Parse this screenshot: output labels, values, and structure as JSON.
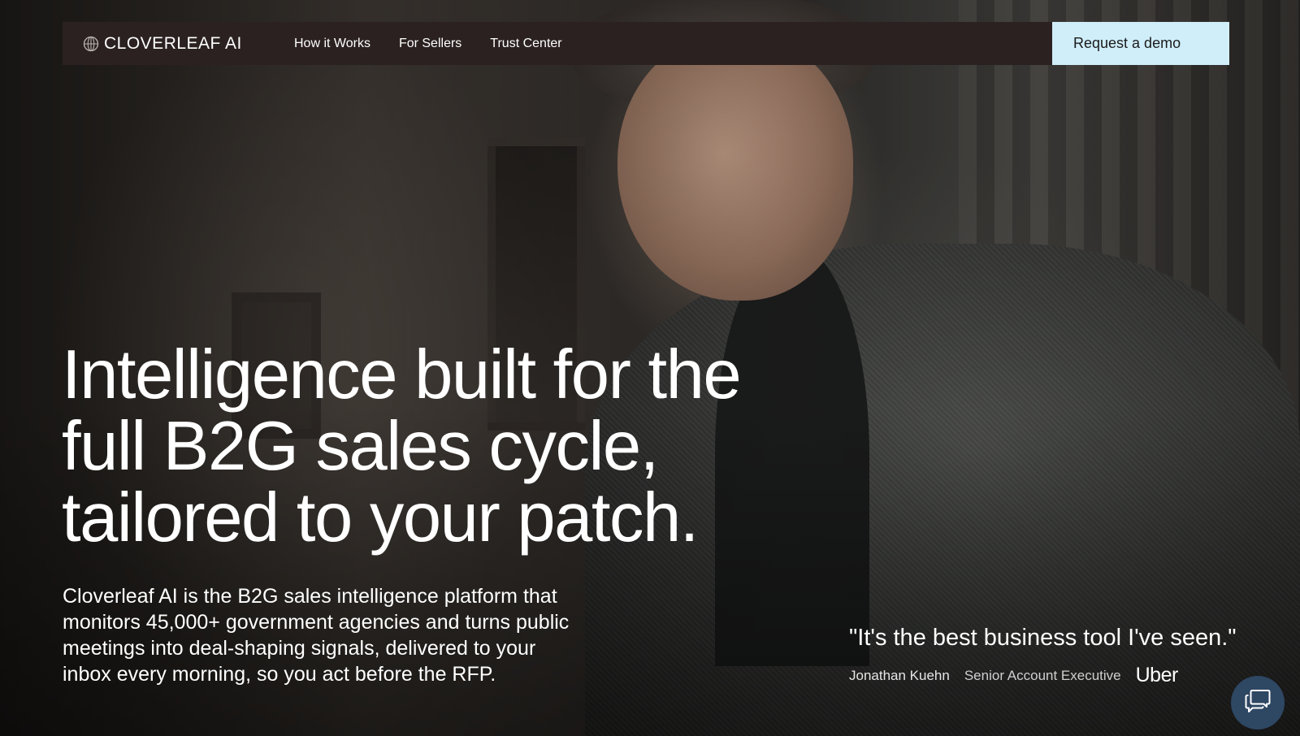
{
  "brand": {
    "name": "CLOVERLEAF AI",
    "icon": "globe-icon"
  },
  "nav": {
    "links": [
      "How it Works",
      "For Sellers",
      "Trust Center"
    ],
    "cta_label": "Request a demo"
  },
  "hero": {
    "headline_lines": [
      "Intelligence built for the",
      "full B2G sales cycle,",
      "tailored to your patch."
    ],
    "subcopy_lines": [
      "Cloverleaf AI is the B2G sales intelligence platform that",
      "monitors 45,000+ government agencies and turns public",
      "meetings into deal-shaping signals, delivered to your",
      "inbox every morning, so you act before the RFP."
    ]
  },
  "testimonial": {
    "quote": "\"It's the best business tool I've seen.\"",
    "name": "Jonathan Kuehn",
    "title": "Senior Account Executive",
    "company": "Uber"
  },
  "chat": {
    "icon": "chat-bubbles-icon"
  },
  "colors": {
    "nav_bg": "#2a2120",
    "cta_bg": "#cfeefa",
    "chat_bg": "#2e4763",
    "text": "#ffffff"
  }
}
